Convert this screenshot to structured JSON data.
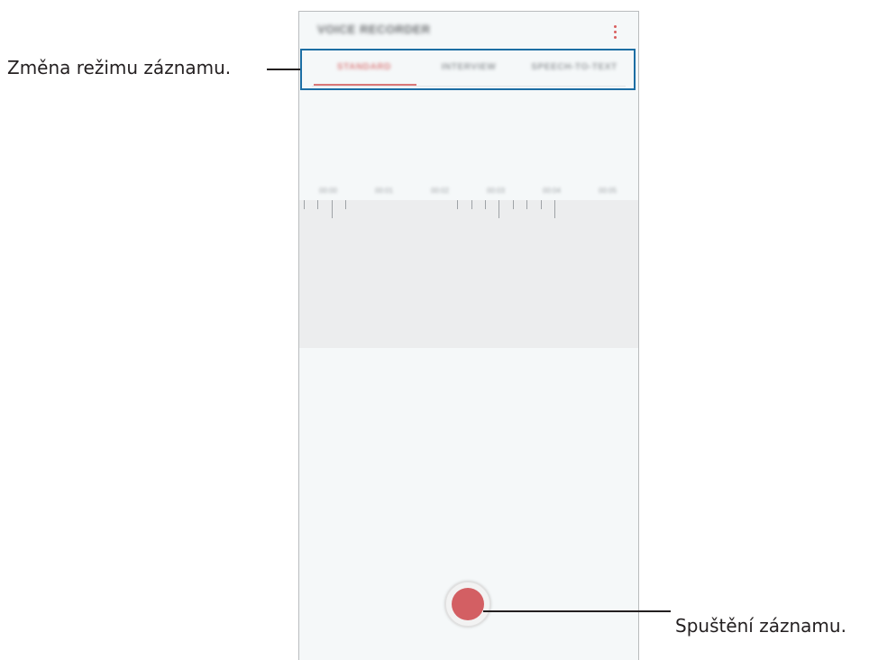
{
  "app": {
    "title": "VOICE RECORDER",
    "more_icon": "more-vertical-icon"
  },
  "tabs": [
    {
      "label": "STANDARD",
      "selected": true
    },
    {
      "label": "INTERVIEW",
      "selected": false
    },
    {
      "label": "SPEECH-TO-TEXT",
      "selected": false
    }
  ],
  "timeline": {
    "labels": [
      "00:00",
      "00:01",
      "00:02",
      "00:03",
      "00:04",
      "00:05"
    ]
  },
  "record_button": {
    "icon": "record-icon",
    "color": "#d35f63"
  },
  "callouts": {
    "mode_change": "Změna režimu záznamu.",
    "start_recording": "Spuštění záznamu."
  },
  "colors": {
    "accent": "#d56060",
    "highlight": "#1c6ea4"
  }
}
